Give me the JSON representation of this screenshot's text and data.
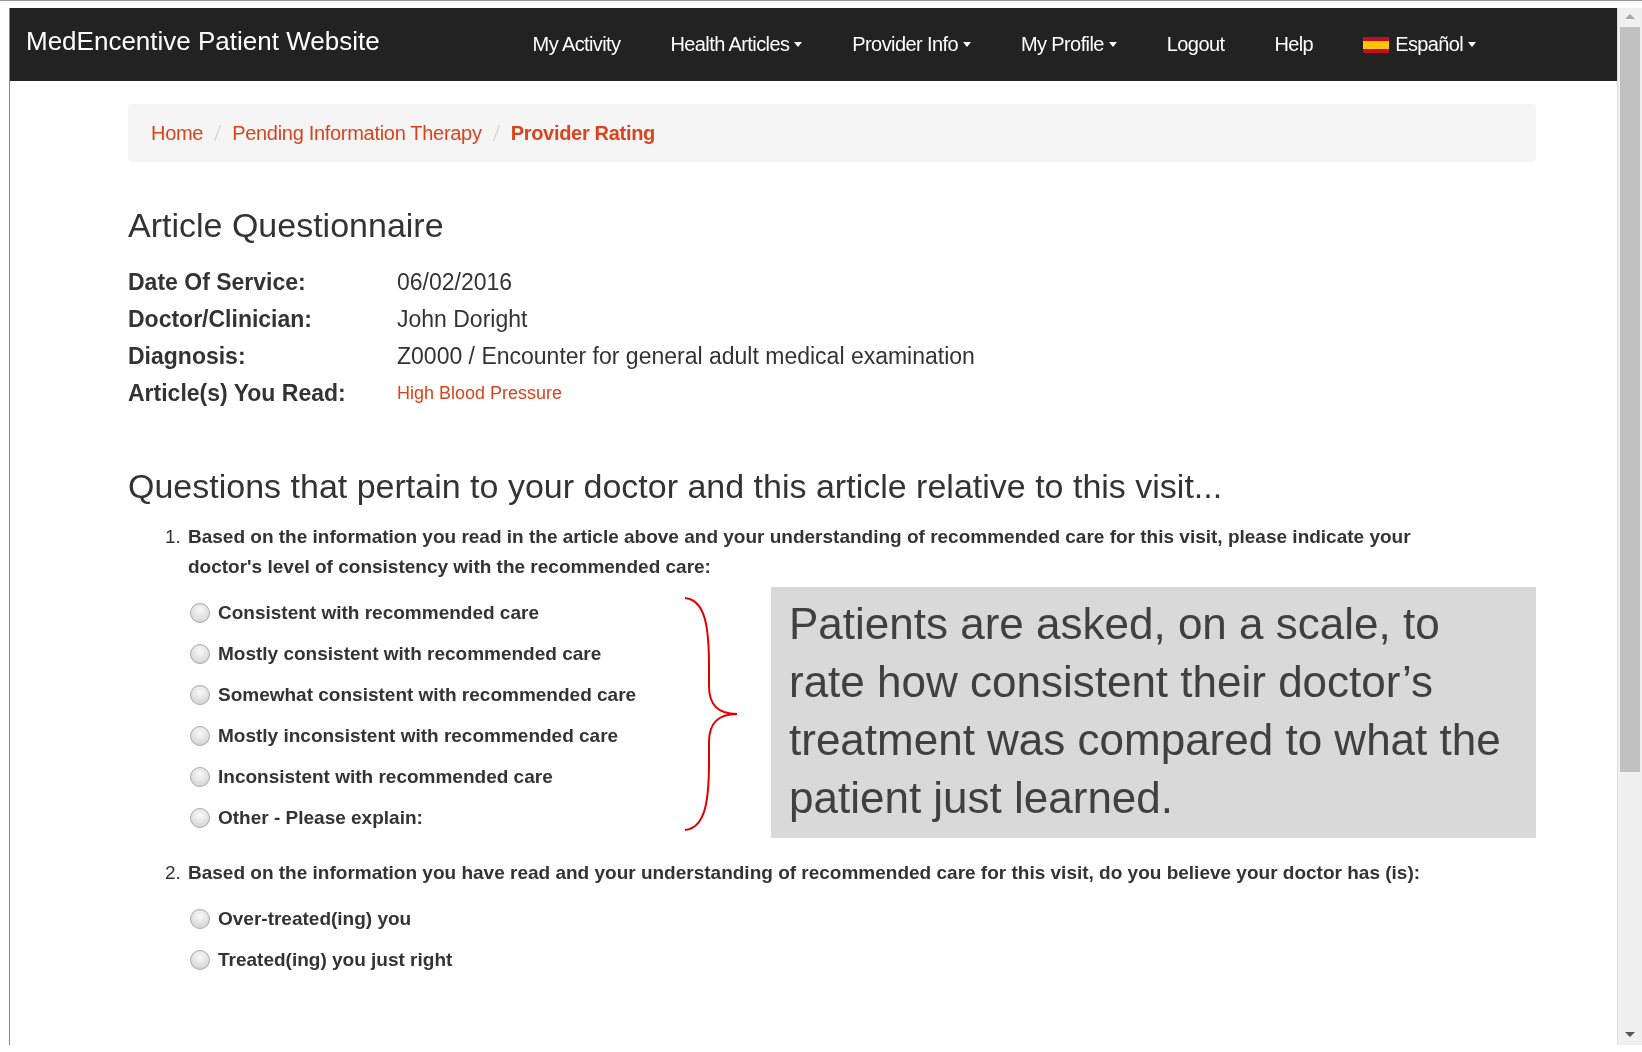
{
  "navbar": {
    "brand": "MedEncentive Patient Website",
    "items": [
      {
        "label": "My Activity",
        "dropdown": false,
        "flag": false
      },
      {
        "label": "Health Articles",
        "dropdown": true,
        "flag": false
      },
      {
        "label": "Provider Info",
        "dropdown": true,
        "flag": false
      },
      {
        "label": "My Profile",
        "dropdown": true,
        "flag": false
      },
      {
        "label": "Logout",
        "dropdown": false,
        "flag": false
      },
      {
        "label": "Help",
        "dropdown": false,
        "flag": false
      },
      {
        "label": "Español",
        "dropdown": true,
        "flag": true
      }
    ]
  },
  "breadcrumb": [
    {
      "label": "Home",
      "selected": false
    },
    {
      "label": "Pending Information Therapy",
      "selected": false
    },
    {
      "label": "Provider Rating",
      "selected": true
    }
  ],
  "title": "Article Questionnaire",
  "details": [
    {
      "label": "Date Of Service:",
      "value": "06/02/2016",
      "kind": "text"
    },
    {
      "label": "Doctor/Clinician:",
      "value": "John Doright",
      "kind": "text"
    },
    {
      "label": "Diagnosis:",
      "value": "Z0000 / Encounter for general adult medical examination",
      "kind": "text"
    },
    {
      "label": "Article(s) You Read:",
      "value": "High Blood Pressure",
      "kind": "link"
    }
  ],
  "questions_heading": "Questions that pertain to your doctor and this article relative to this visit...",
  "questions": [
    {
      "number": "1.",
      "text": "Based on the information you read in the article above and your understanding of recommended care for this visit, please indicate your doctor's level of consistency with the recommended care:",
      "options": [
        {
          "label": "Consistent with recommended care",
          "selected": false
        },
        {
          "label": "Mostly consistent with recommended care",
          "selected": false
        },
        {
          "label": "Somewhat consistent with recommended care",
          "selected": false
        },
        {
          "label": "Mostly inconsistent with recommended care",
          "selected": false
        },
        {
          "label": "Inconsistent with recommended care",
          "selected": false
        },
        {
          "label": "Other - Please explain:",
          "selected": false
        }
      ],
      "callout": "Patients are asked, on a scale, to rate how consistent their doctor’s treatment was compared to what the patient just learned."
    },
    {
      "number": "2.",
      "text": "Based on the information you have read and your understanding of recommended care for this visit, do you believe your doctor has (is):",
      "options": [
        {
          "label": "Over-treated(ing) you",
          "selected": false
        },
        {
          "label": "Treated(ing) you just right",
          "selected": false
        }
      ]
    }
  ]
}
